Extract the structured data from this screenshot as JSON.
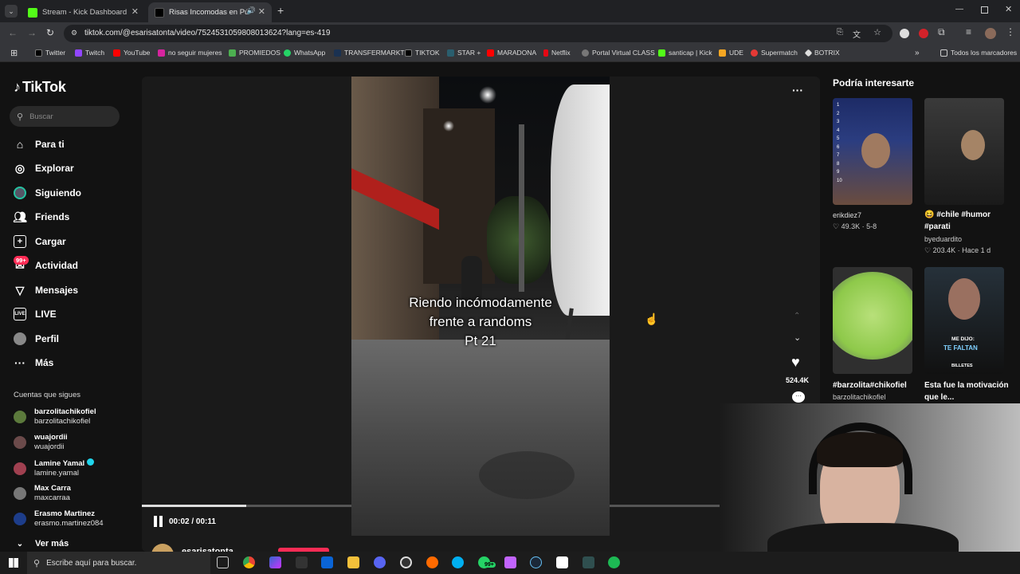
{
  "browser": {
    "tabs": [
      {
        "label": "Stream - Kick Dashboard"
      },
      {
        "label": "Risas Incomodas en Públicc"
      }
    ],
    "url": "tiktok.com/@esarisatonta/video/7524531059808013624?lang=es-419",
    "bookmarks": [
      "Twitter",
      "Twitch",
      "YouTube",
      "no seguir mujeres",
      "PROMIEDOS",
      "WhatsApp",
      "TRANSFERMARKT",
      "TIKTOK",
      "STAR +",
      "MARADONA",
      "Netflix",
      "Portal Virtual CLASS",
      "santicap | Kick",
      "UDE",
      "Supermatch",
      "BOTRIX"
    ],
    "all_bookmarks": "Todos los marcadores"
  },
  "tiktok": {
    "logo": "TikTok",
    "search_placeholder": "Buscar",
    "nav": [
      {
        "label": "Para ti"
      },
      {
        "label": "Explorar"
      },
      {
        "label": "Siguiendo"
      },
      {
        "label": "Friends"
      },
      {
        "label": "Cargar"
      },
      {
        "label": "Actividad"
      },
      {
        "label": "Mensajes"
      },
      {
        "label": "LIVE"
      },
      {
        "label": "Perfil"
      },
      {
        "label": "Más"
      }
    ],
    "activity_badge": "99+",
    "following_title": "Cuentas que sigues",
    "following": [
      {
        "name": "barzolitachikofiel",
        "handle": "barzolitachikofiel"
      },
      {
        "name": "wuajordii",
        "handle": "wuajordii"
      },
      {
        "name": "Lamine Yamal",
        "handle": "lamine.yamal"
      },
      {
        "name": "Max Carra",
        "handle": "maxcarraa"
      },
      {
        "name": "Erasmo Martinez",
        "handle": "erasmo.martinez084"
      }
    ],
    "see_more": "Ver más",
    "video": {
      "caption_line1": "Riendo incómodamente",
      "caption_line2": "frente a randoms",
      "caption_line3": "Pt 21",
      "time": "00:02 / 00:11",
      "progress": 0.18,
      "likes": "524.4K",
      "author": "esarisatonta"
    },
    "suggest_title": "Podría interesarte",
    "suggestions": [
      {
        "title": "erikdiez7",
        "meta": "49.3K · 5-8"
      },
      {
        "title": "😆 #chile #humor #parati",
        "author": "byeduardito",
        "meta": "203.4K · Hace 1 d"
      },
      {
        "title": "#barzolita#chikofiel",
        "author": "barzolitachikofiel"
      },
      {
        "title": "Esta fue la motivación que le...",
        "thumb_text1": "ME DIJO:",
        "thumb_text2": "TE FALTAN",
        "thumb_text3": "BILLETES"
      }
    ]
  },
  "taskbar": {
    "search_placeholder": "Escribe aquí para buscar.",
    "badge": "99+"
  }
}
